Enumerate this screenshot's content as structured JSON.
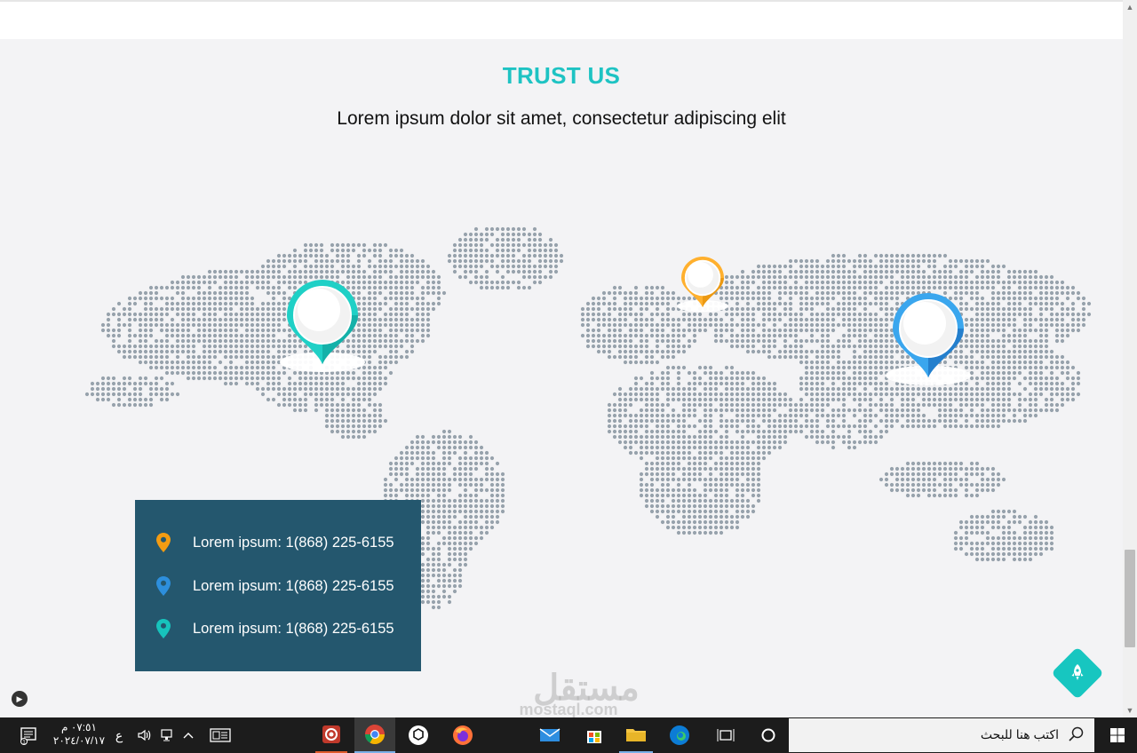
{
  "section": {
    "title": "TRUST US",
    "subtitle": "Lorem ipsum dolor sit amet, consectetur adipiscing elit"
  },
  "colors": {
    "accent": "#1ec3c3",
    "panel": "#24576e",
    "pin_orange": "#f39c12",
    "pin_blue": "#2d8fdd",
    "pin_teal": "#17c3bc",
    "map_dot": "#97a2ac"
  },
  "map": {
    "markers": [
      {
        "name": "north-america",
        "color": "teal"
      },
      {
        "name": "europe",
        "color": "orange"
      },
      {
        "name": "asia",
        "color": "blue"
      }
    ]
  },
  "contacts": [
    {
      "icon": "map-pin-orange-icon",
      "text": "Lorem ipsum: 1(868) 225-6155"
    },
    {
      "icon": "map-pin-blue-icon",
      "text": "Lorem ipsum: 1(868) 225-6155"
    },
    {
      "icon": "map-pin-teal-icon",
      "text": "Lorem ipsum: 1(868) 225-6155"
    }
  ],
  "watermark": {
    "arabic": "مستقل",
    "latin": "mostaql.com"
  },
  "taskbar": {
    "search_placeholder": "اكتب هنا للبحث",
    "time": "٠٧:٥١ م",
    "date": "٢٠٢٤/٠٧/١٧",
    "language": "ع",
    "notification_count": "1"
  }
}
